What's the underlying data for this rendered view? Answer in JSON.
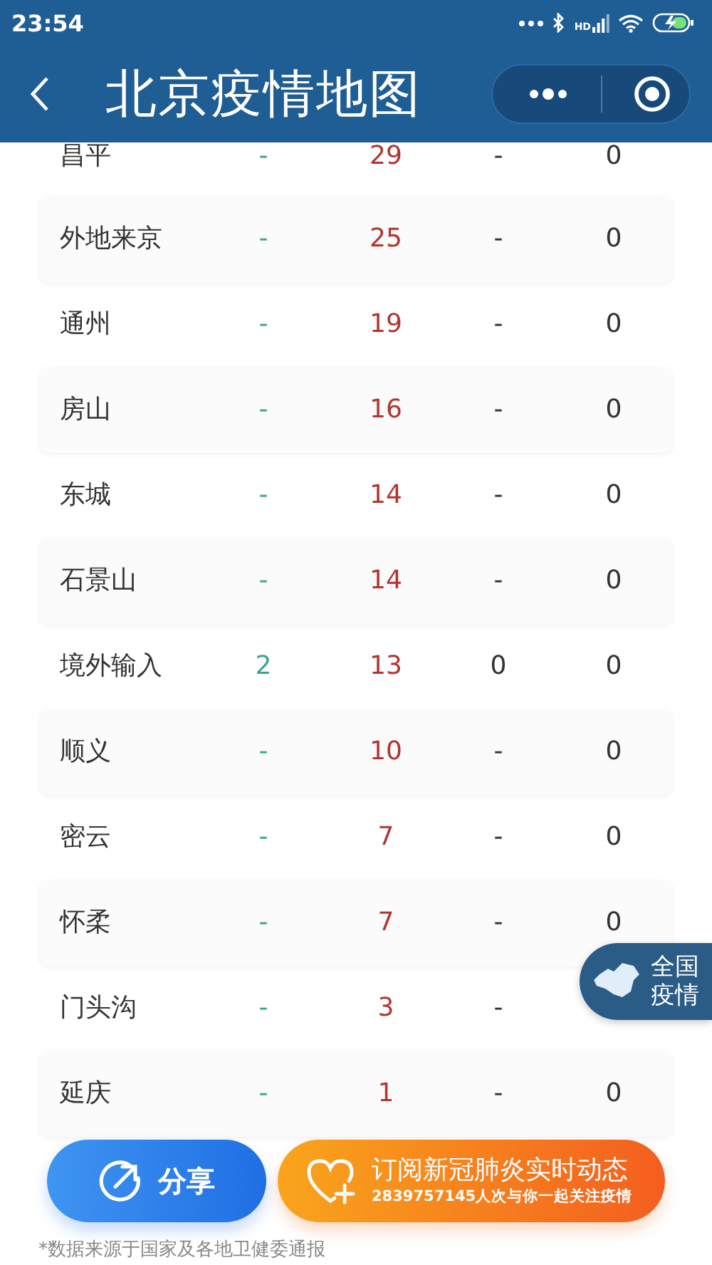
{
  "status_bar": {
    "time": "23:54",
    "network": "HD"
  },
  "header": {
    "title": "北京疫情地图"
  },
  "table": {
    "rows": [
      {
        "name": "昌平",
        "cells": [
          "-",
          "29",
          "-",
          "0"
        ]
      },
      {
        "name": "外地来京",
        "cells": [
          "-",
          "25",
          "-",
          "0"
        ]
      },
      {
        "name": "通州",
        "cells": [
          "-",
          "19",
          "-",
          "0"
        ]
      },
      {
        "name": "房山",
        "cells": [
          "-",
          "16",
          "-",
          "0"
        ]
      },
      {
        "name": "东城",
        "cells": [
          "-",
          "14",
          "-",
          "0"
        ]
      },
      {
        "name": "石景山",
        "cells": [
          "-",
          "14",
          "-",
          "0"
        ]
      },
      {
        "name": "境外输入",
        "cells": [
          "2",
          "13",
          "0",
          "0"
        ]
      },
      {
        "name": "顺义",
        "cells": [
          "-",
          "10",
          "-",
          "0"
        ]
      },
      {
        "name": "密云",
        "cells": [
          "-",
          "7",
          "-",
          "0"
        ]
      },
      {
        "name": "怀柔",
        "cells": [
          "-",
          "7",
          "-",
          "0"
        ]
      },
      {
        "name": "门头沟",
        "cells": [
          "-",
          "3",
          "-"
        ]
      },
      {
        "name": "延庆",
        "cells": [
          "-",
          "1",
          "-",
          "0"
        ]
      }
    ]
  },
  "floating_badge": {
    "label": "全国疫情"
  },
  "actions": {
    "share": "分享",
    "subscribe": {
      "title": "订阅新冠肺炎实时动态",
      "subtitle": "2839757145人次与你一起关注疫情"
    }
  },
  "footnote": "*数据来源于国家及各地卫健委通报"
}
